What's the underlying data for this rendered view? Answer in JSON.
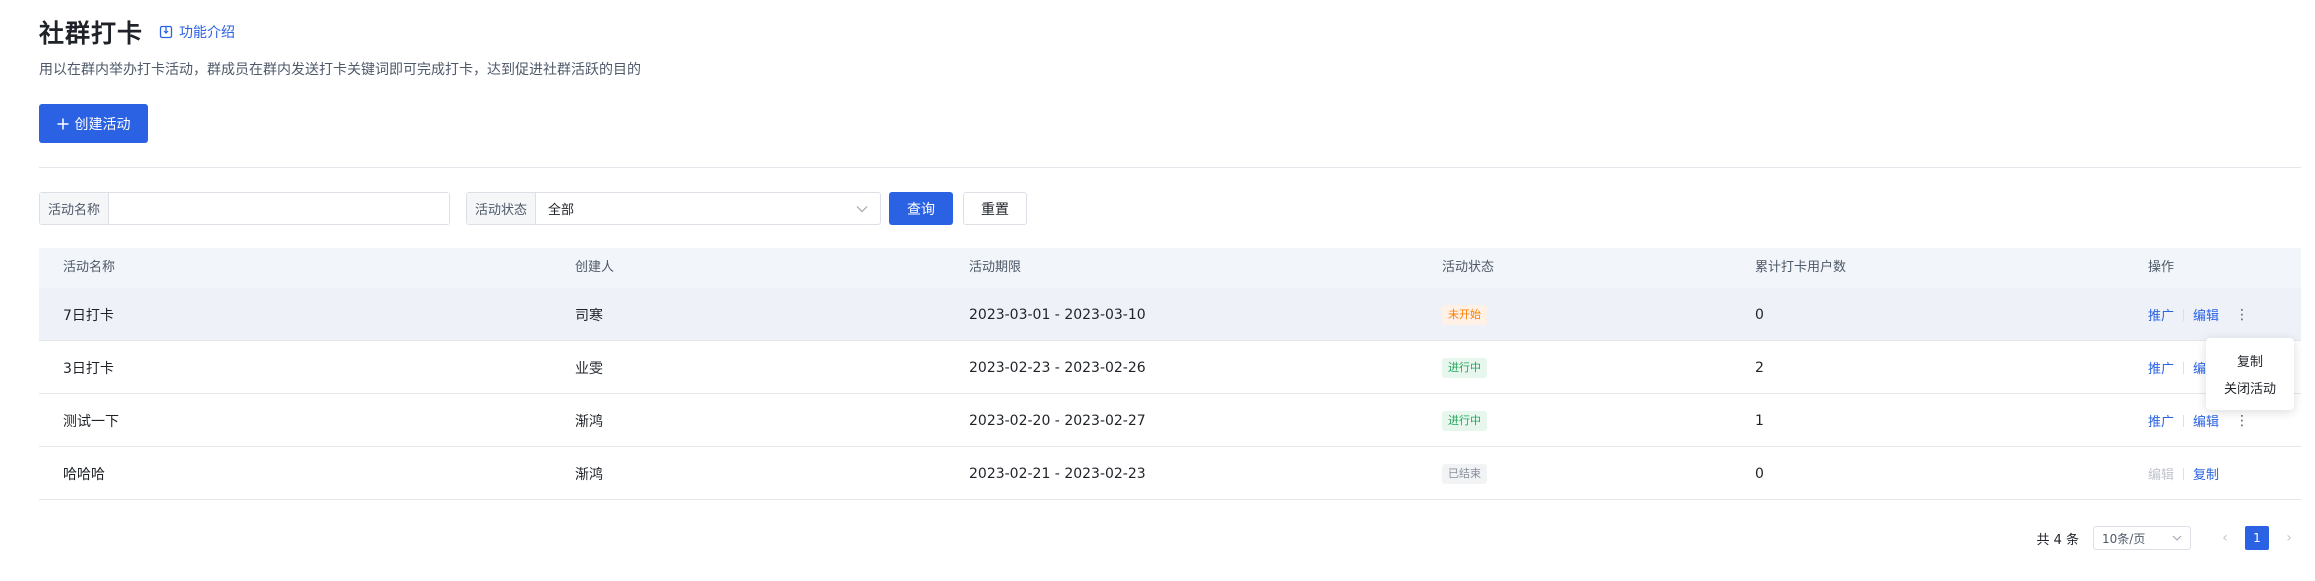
{
  "header": {
    "title": "社群打卡",
    "intro_link": "功能介绍",
    "description": "用以在群内举办打卡活动，群成员在群内发送打卡关键词即可完成打卡，达到促进社群活跃的目的"
  },
  "actions": {
    "create_label": "创建活动"
  },
  "filters": {
    "name_label": "活动名称",
    "name_value": "",
    "status_label": "活动状态",
    "status_value": "全部",
    "query_label": "查询",
    "reset_label": "重置"
  },
  "table": {
    "columns": [
      "活动名称",
      "创建人",
      "活动期限",
      "活动状态",
      "累计打卡用户数",
      "操作"
    ],
    "rows": [
      {
        "name": "7日打卡",
        "creator": "司寒",
        "period": "2023-03-01 - 2023-03-10",
        "status": "未开始",
        "count": "0",
        "op1": "推广",
        "op2": "编辑"
      },
      {
        "name": "3日打卡",
        "creator": "业雯",
        "period": "2023-02-23 - 2023-02-26",
        "status": "进行中",
        "count": "2",
        "op1": "推广",
        "op2": "编"
      },
      {
        "name": "测试一下",
        "creator": "渐鸿",
        "period": "2023-02-20 - 2023-02-27",
        "status": "进行中",
        "count": "1",
        "op1": "推广",
        "op2": "编辑"
      },
      {
        "name": "哈哈哈",
        "creator": "渐鸿",
        "period": "2023-02-21 - 2023-02-23",
        "status": "已结束",
        "count": "0",
        "op1": "编辑",
        "op2": "复制"
      }
    ]
  },
  "dropdown": {
    "items": [
      "复制",
      "关闭活动"
    ]
  },
  "pagination": {
    "total": "共 4 条",
    "page_size": "10条/页",
    "current": "1"
  },
  "colors": {
    "primary": "#2b62e3",
    "pending": "#ff7d00",
    "running": "#23a55a",
    "ended": "#86909c"
  }
}
